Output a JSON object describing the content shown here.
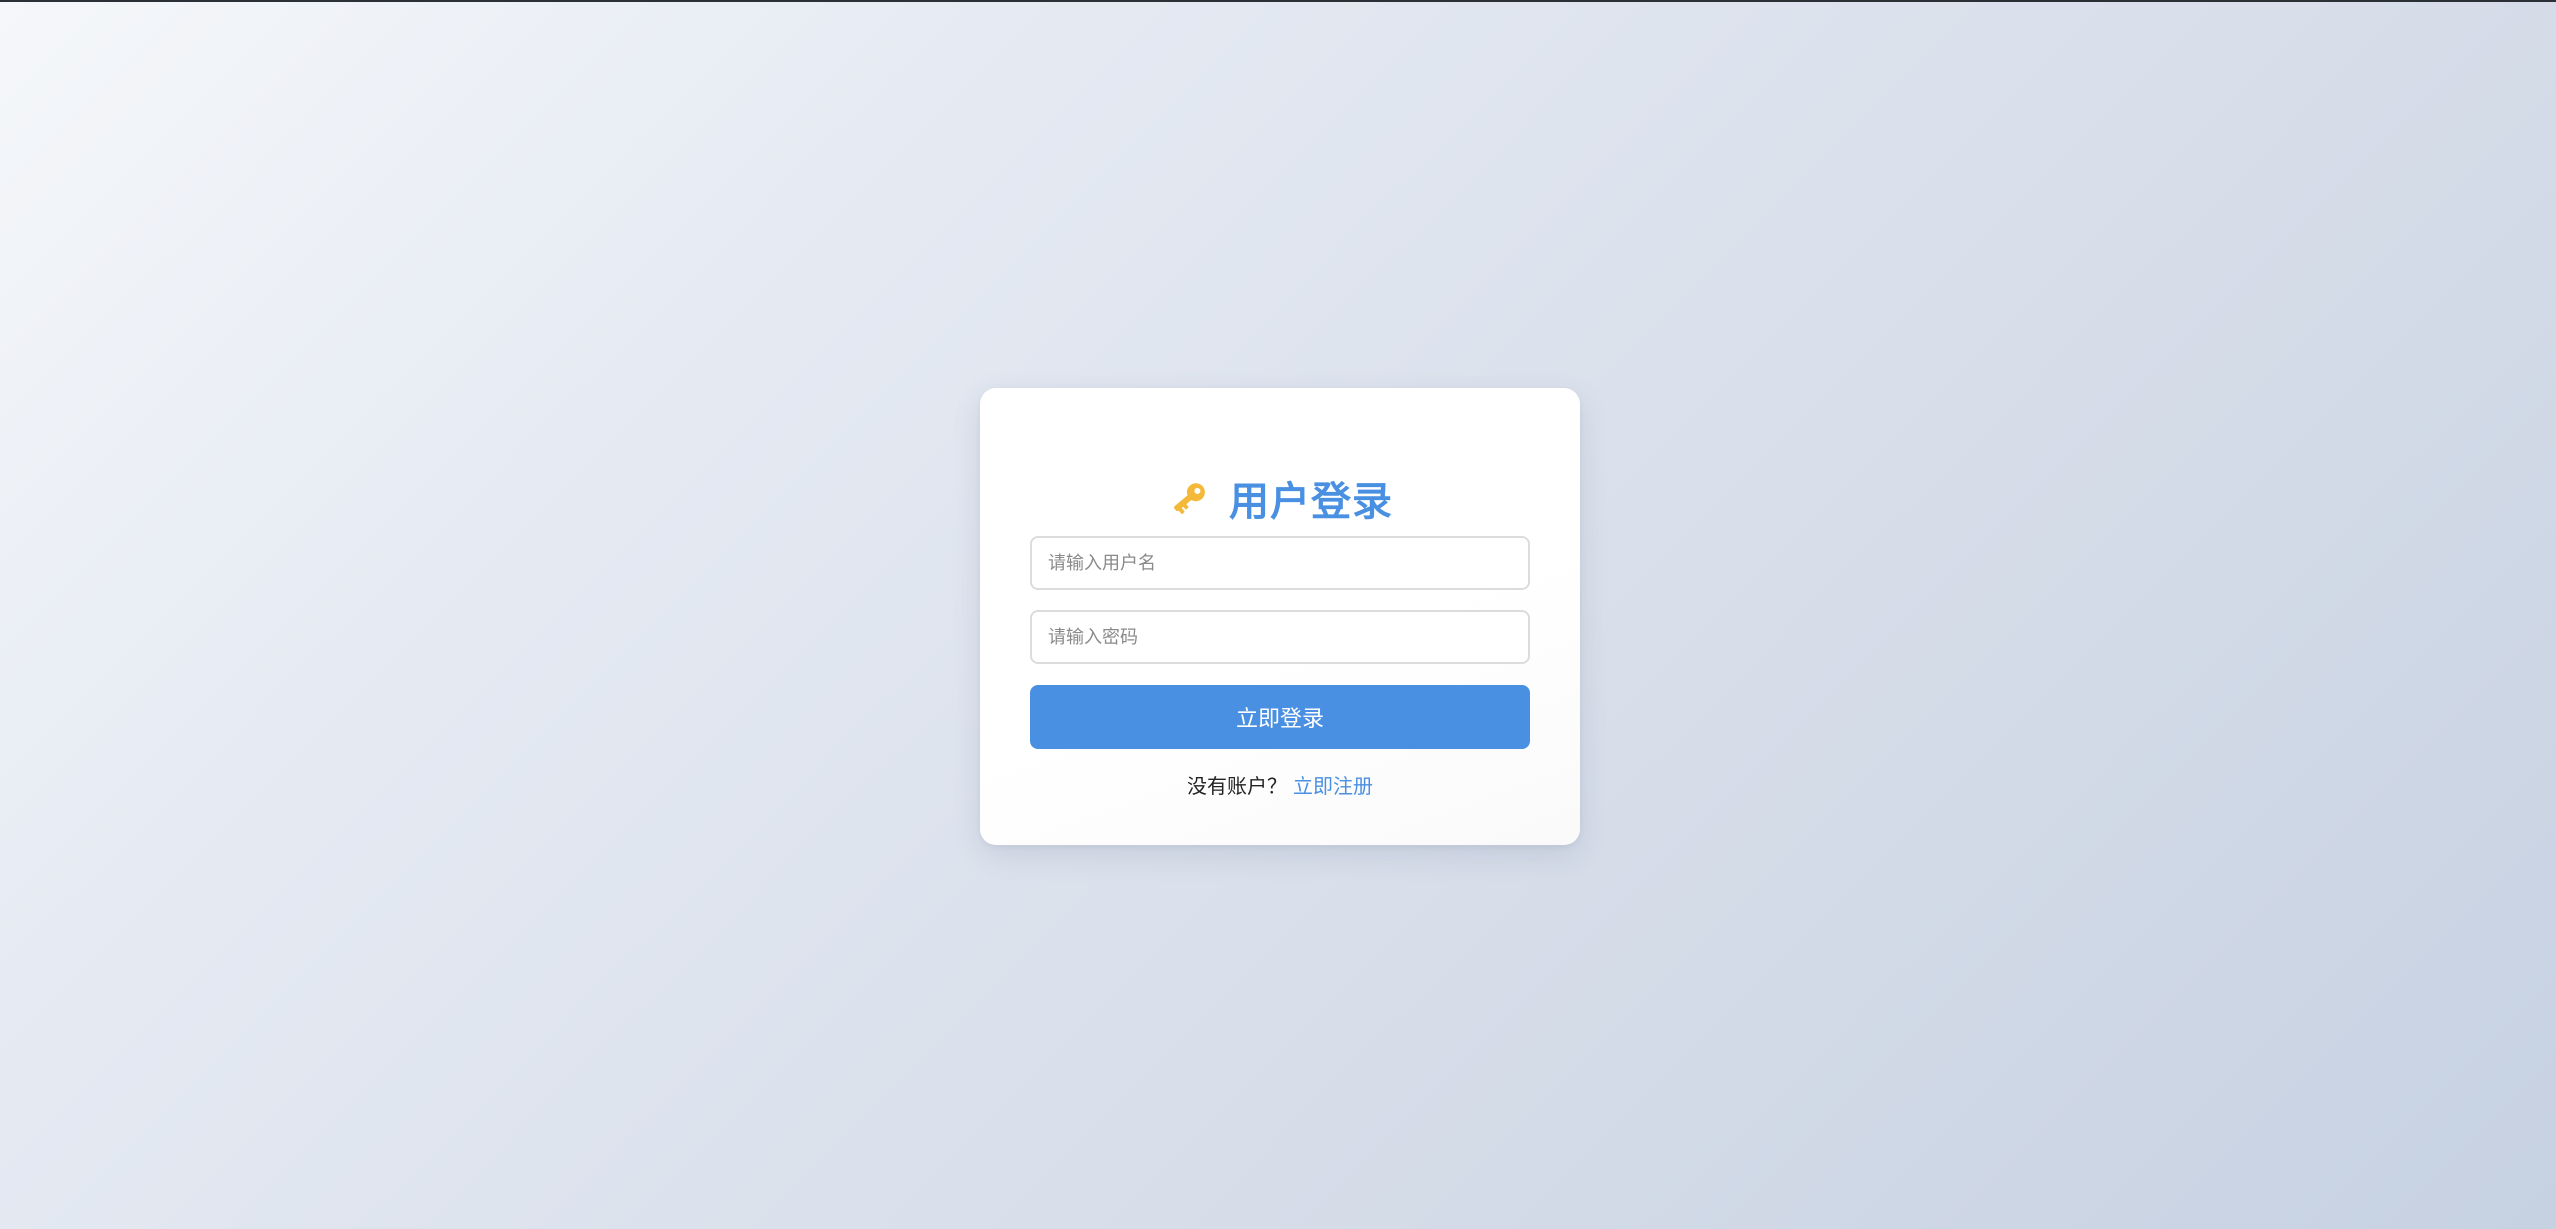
{
  "login": {
    "title": "用户登录",
    "icon": "key-icon",
    "username_placeholder": "请输入用户名",
    "password_placeholder": "请输入密码",
    "submit_label": "立即登录",
    "no_account_text": "没有账户？",
    "register_link": "立即注册"
  },
  "colors": {
    "accent": "#4a90e2",
    "key_icon": "#f5b93a"
  }
}
